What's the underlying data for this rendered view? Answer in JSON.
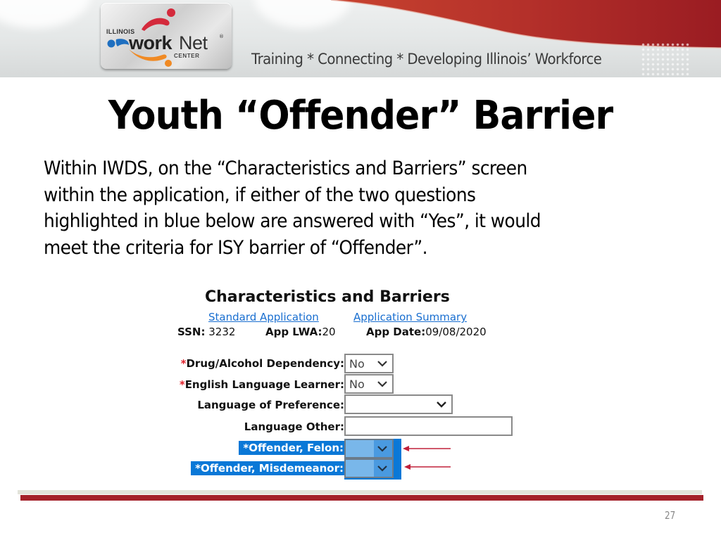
{
  "header": {
    "logo": {
      "line1": "ILLINOIS",
      "work": "work",
      "net": "Net",
      "registered": "®",
      "center": "CENTER",
      "colors": {
        "red": "#d42a3c",
        "blue": "#1f6fc0",
        "orange": "#f08a24"
      }
    },
    "tagline": "Training * Connecting * Developing Illinois’ Workforce",
    "accent_color": "#a4212a"
  },
  "slide": {
    "title": "Youth “Offender” Barrier",
    "body_lines": [
      "Within IWDS, on the “Characteristics and Barriers” screen",
      "within the application, if either of the two questions",
      "highlighted in blue below are answered with “Yes”, it would",
      "meet the criteria for ISY barrier of “Offender”."
    ],
    "page_number": "27"
  },
  "form": {
    "heading": "Characteristics and Barriers",
    "links": [
      {
        "label": "Standard Application"
      },
      {
        "label": "Application Summary"
      }
    ],
    "meta": {
      "ssn_label": "SSN:",
      "ssn_value": " 3232",
      "lwa_label": "App LWA:",
      "lwa_value": "20",
      "date_label": "App Date:",
      "date_value": "09/08/2020"
    },
    "fields": [
      {
        "label": "Drug/Alcohol Dependency:",
        "required": "*",
        "type": "select",
        "value": "No"
      },
      {
        "label": "English Language Learner:",
        "required": "*",
        "type": "select",
        "value": "No"
      },
      {
        "label": "Language of Preference:",
        "required": "",
        "type": "select",
        "value": ""
      },
      {
        "label": "Language Other:",
        "required": "",
        "type": "text",
        "value": ""
      },
      {
        "label": "Offender, Felon:",
        "required": "*",
        "type": "select",
        "value": "",
        "highlighted": true
      },
      {
        "label": "Offender, Misdemeanor:",
        "required": "*",
        "type": "select",
        "value": "",
        "highlighted": true
      }
    ],
    "highlight_color": "#0a78d7",
    "arrow_color": "#c0203a"
  }
}
